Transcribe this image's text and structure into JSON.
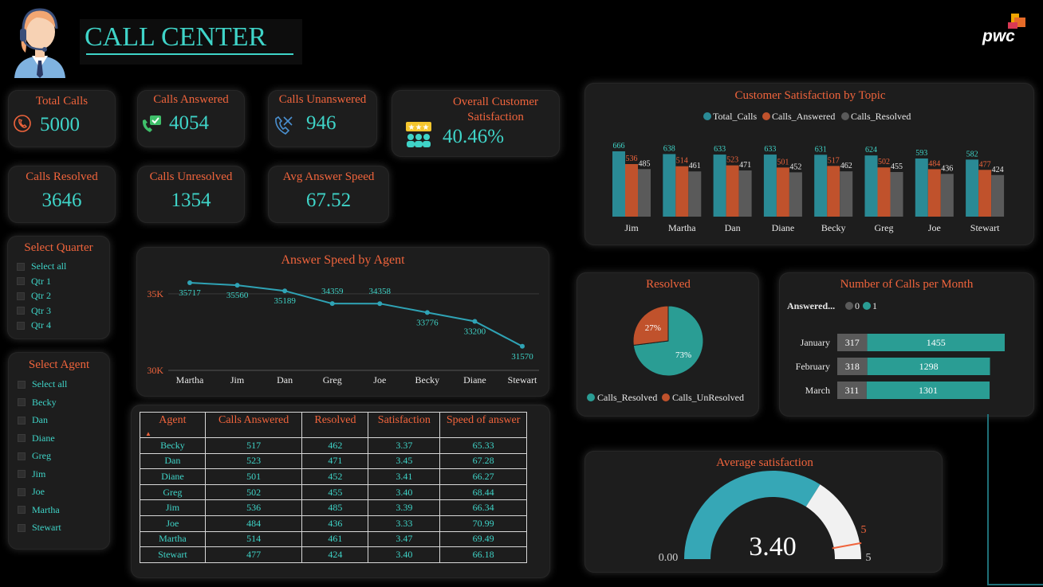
{
  "header": {
    "title": "CALL CENTER",
    "logo_text": "pwc"
  },
  "kpis": {
    "total_calls": {
      "label": "Total Calls",
      "value": "5000",
      "icon": "phone-icon"
    },
    "calls_answered": {
      "label": "Calls Answered",
      "value": "4054",
      "icon": "answered-call-icon"
    },
    "calls_unanswered": {
      "label": "Calls Unanswered",
      "value": "946",
      "icon": "missed-call-icon"
    },
    "overall_satisfaction": {
      "label": "Overall Customer Satisfaction",
      "value": "40.46%",
      "icon": "rating-icon"
    },
    "calls_resolved": {
      "label": "Calls Resolved",
      "value": "3646"
    },
    "calls_unresolved": {
      "label": "Calls Unresolved",
      "value": "1354"
    },
    "avg_answer_speed": {
      "label": "Avg Answer Speed",
      "value": "67.52"
    }
  },
  "quarter_slicer": {
    "title": "Select Quarter",
    "items": [
      "Select all",
      "Qtr 1",
      "Qtr 2",
      "Qtr 3",
      "Qtr 4"
    ]
  },
  "agent_slicer": {
    "title": "Select Agent",
    "items": [
      "Select all",
      "Becky",
      "Dan",
      "Diane",
      "Greg",
      "Jim",
      "Joe",
      "Martha",
      "Stewart"
    ]
  },
  "table": {
    "columns": [
      "Agent",
      "Calls Answered",
      "Resolved",
      "Satisfaction",
      "Speed of answer"
    ],
    "rows": [
      [
        "Becky",
        "517",
        "462",
        "3.37",
        "65.33"
      ],
      [
        "Dan",
        "523",
        "471",
        "3.45",
        "67.28"
      ],
      [
        "Diane",
        "501",
        "452",
        "3.41",
        "66.27"
      ],
      [
        "Greg",
        "502",
        "455",
        "3.40",
        "68.44"
      ],
      [
        "Jim",
        "536",
        "485",
        "3.39",
        "66.34"
      ],
      [
        "Joe",
        "484",
        "436",
        "3.33",
        "70.99"
      ],
      [
        "Martha",
        "514",
        "461",
        "3.47",
        "69.49"
      ],
      [
        "Stewart",
        "477",
        "424",
        "3.40",
        "66.18"
      ]
    ]
  },
  "gauge_panel": {
    "title": "Average satisfaction",
    "value_label": "3.40",
    "min_label": "0.00",
    "max_label": "5",
    "target_label": "5"
  },
  "colors": {
    "accent_orange": "#f0643c",
    "teal": "#3fd4c8",
    "bar_teal": "#2a8a95",
    "bar_orange": "#c0522c",
    "bar_gray": "#5a5a5a"
  },
  "chart_data": [
    {
      "type": "line",
      "title": "Answer Speed by Agent",
      "categories": [
        "Martha",
        "Jim",
        "Dan",
        "Greg",
        "Joe",
        "Becky",
        "Diane",
        "Stewart"
      ],
      "values": [
        35717,
        35560,
        35189,
        34359,
        34358,
        33776,
        33200,
        31570
      ],
      "value_labels": [
        "35717",
        "35560",
        "35189",
        "34359",
        "34358",
        "33776",
        "33200",
        "31570"
      ],
      "ytick_labels": [
        "35K",
        "30K"
      ],
      "yticks": [
        35000,
        30000
      ],
      "ylim": [
        30000,
        36500
      ]
    },
    {
      "type": "bar",
      "title": "Customer Satisfaction by Topic",
      "categories": [
        "Jim",
        "Martha",
        "Dan",
        "Diane",
        "Becky",
        "Greg",
        "Joe",
        "Stewart"
      ],
      "legend_placement": "top",
      "series": [
        {
          "name": "Total_Calls",
          "color": "#2a8a95",
          "label_color": "#3fd4c8",
          "values": [
            666,
            638,
            633,
            633,
            631,
            624,
            593,
            582
          ]
        },
        {
          "name": "Calls_Answered",
          "color": "#c0522c",
          "label_color": "#f0643c",
          "values": [
            536,
            514,
            523,
            501,
            517,
            502,
            484,
            477
          ]
        },
        {
          "name": "Calls_Resolved",
          "color": "#5a5a5a",
          "label_color": "#e8e8e8",
          "values": [
            485,
            461,
            471,
            452,
            462,
            455,
            436,
            424
          ]
        }
      ],
      "ylim": [
        0,
        700
      ]
    },
    {
      "type": "pie",
      "title": "Resolved",
      "labels": [
        "Calls_Resolved",
        "Calls_UnResolved"
      ],
      "values": [
        73,
        27
      ],
      "value_labels": [
        "73%",
        "27%"
      ],
      "colors": [
        "#2a9d94",
        "#c0522c"
      ],
      "legend_placement": "bottom"
    },
    {
      "type": "bar",
      "orientation": "horizontal",
      "title": "Number of Calls per Month",
      "legend_title": "Answered...",
      "categories": [
        "January",
        "February",
        "March"
      ],
      "series": [
        {
          "name": "0",
          "color": "#5a5a5a",
          "values": [
            317,
            318,
            311
          ]
        },
        {
          "name": "1",
          "color": "#2a9d94",
          "values": [
            1455,
            1298,
            1301
          ]
        }
      ]
    },
    {
      "type": "gauge",
      "title": "Average satisfaction",
      "value": 3.4,
      "min": 0,
      "max": 5,
      "target": 5
    }
  ]
}
